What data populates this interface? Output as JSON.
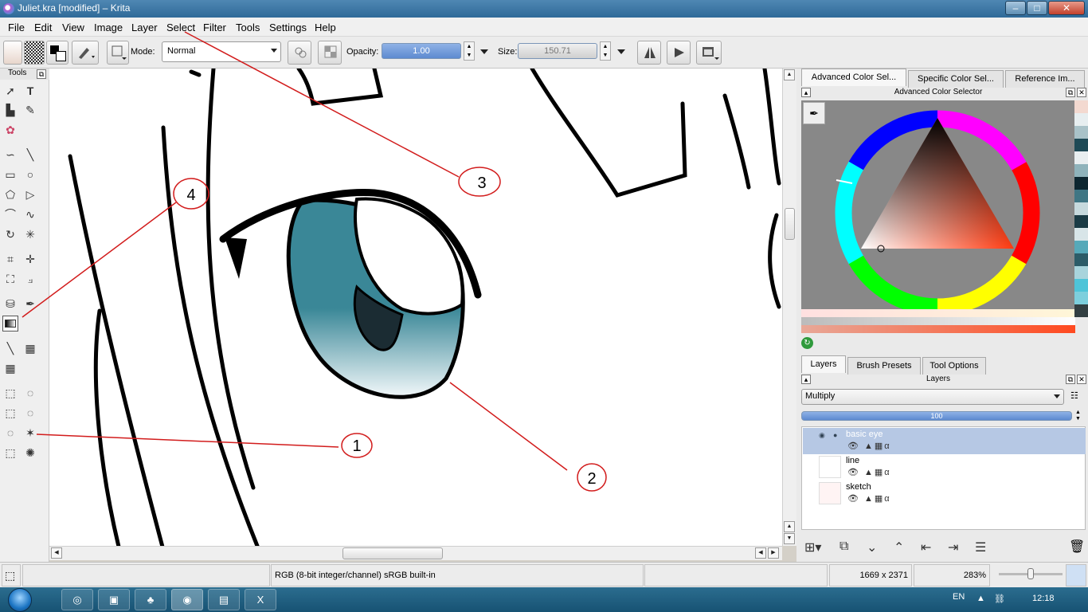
{
  "window": {
    "title": "Juliet.kra [modified] – Krita",
    "min_label": "–",
    "max_label": "□",
    "close_label": "✕"
  },
  "menu": [
    "File",
    "Edit",
    "View",
    "Image",
    "Layer",
    "Select",
    "Filter",
    "Tools",
    "Settings",
    "Help"
  ],
  "toolbar": {
    "mode_label": "Mode:",
    "mode_value": "Normal",
    "opacity_label": "Opacity:",
    "opacity_value": "1.00",
    "size_label": "Size:",
    "size_value": "150.71"
  },
  "tools": {
    "header": "Tools",
    "selected": "gradient-tool"
  },
  "dock": {
    "top_tabs": [
      "Advanced Color Sel...",
      "Specific Color Sel...",
      "Reference Im..."
    ],
    "color_header": "Advanced Color Selector",
    "layer_tabs": [
      "Layers",
      "Brush Presets",
      "Tool Options"
    ],
    "layers_header": "Layers",
    "blend_mode": "Multiply",
    "layer_opacity": "100",
    "layers": [
      {
        "name": "basic eye",
        "active": true
      },
      {
        "name": "line",
        "active": false
      },
      {
        "name": "sketch",
        "active": false
      }
    ]
  },
  "status": {
    "color_info": "RGB (8-bit integer/channel)  sRGB built-in",
    "dimensions": "1669 x 2371",
    "zoom": "283%"
  },
  "taskbar": {
    "language": "EN",
    "time": "12:18"
  },
  "annotations": [
    "1",
    "2",
    "3",
    "4"
  ],
  "colors": {
    "eye_teal": "#3a8797",
    "pupil": "#1b2c33",
    "annotation_red": "#d21c1c",
    "layer_highlight": "#b6c8e4"
  }
}
